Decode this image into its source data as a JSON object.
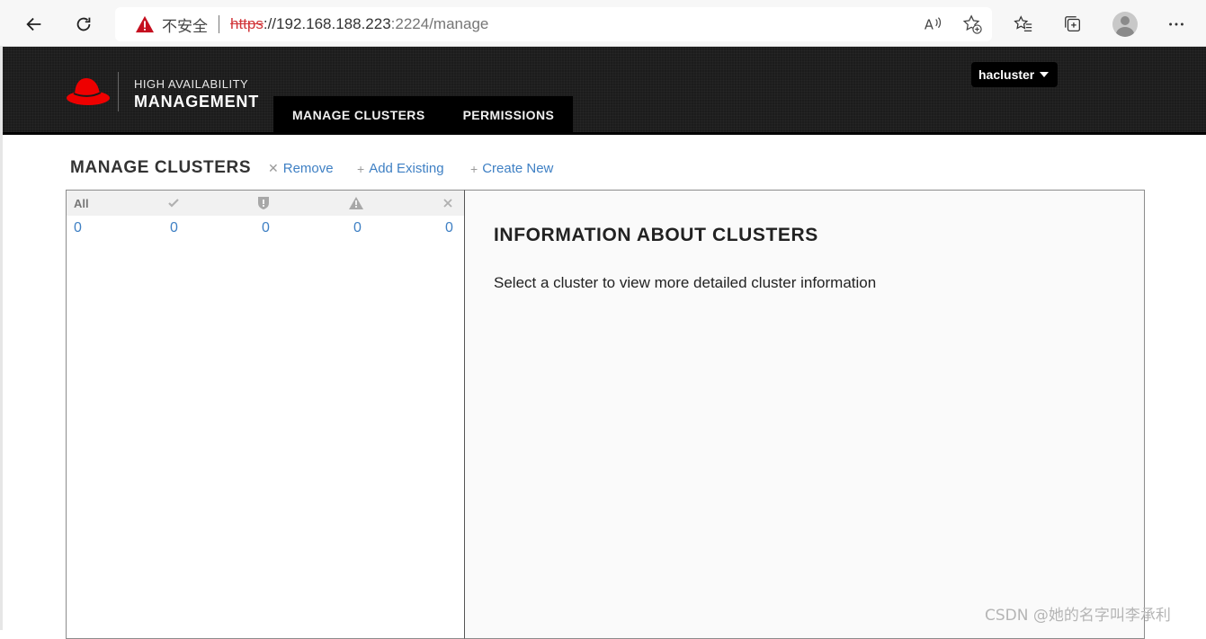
{
  "browser": {
    "insecure_label": "不安全",
    "url_protocol": "https",
    "url_host": "://192.168.188.223",
    "url_port": ":2224",
    "url_path": "/manage"
  },
  "header": {
    "brand_top": "HIGH AVAILABILITY",
    "brand_main": "MANAGEMENT",
    "nav": [
      {
        "label": "MANAGE CLUSTERS"
      },
      {
        "label": "PERMISSIONS"
      }
    ],
    "user": "hacluster"
  },
  "toolbar": {
    "title": "MANAGE CLUSTERS",
    "remove": "Remove",
    "add_existing": "Add Existing",
    "create_new": "Create New"
  },
  "clusters": {
    "status_all_label": "All",
    "counts": [
      "0",
      "0",
      "0",
      "0",
      "0"
    ]
  },
  "info": {
    "title": "INFORMATION ABOUT CLUSTERS",
    "text": "Select a cluster to view more detailed cluster information"
  },
  "watermark": "CSDN @她的名字叫李承利",
  "colors": {
    "header_bg": "#1c1c1c",
    "nav_bg": "#000000",
    "link_blue": "#3f80c4",
    "redhat_red": "#ee0000"
  }
}
